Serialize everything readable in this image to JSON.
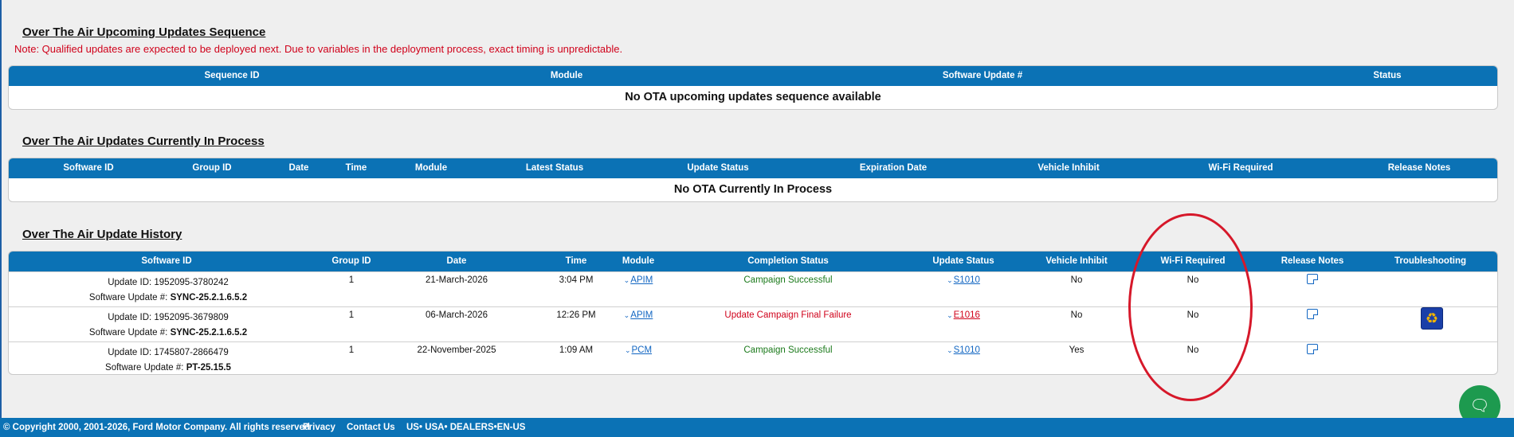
{
  "upcoming": {
    "title": "Over The Air Upcoming Updates Sequence",
    "note": "Note: Qualified updates are expected to be deployed next. Due to variables in the deployment process, exact timing is unpredictable.",
    "headers": [
      "Sequence ID",
      "Module",
      "Software Update #",
      "Status"
    ],
    "empty_message": "No OTA upcoming updates sequence available"
  },
  "in_process": {
    "title": "Over The Air Updates Currently In Process",
    "headers": [
      "Software ID",
      "Group ID",
      "Date",
      "Time",
      "Module",
      "Latest Status",
      "Update Status",
      "Expiration Date",
      "Vehicle Inhibit",
      "Wi-Fi Required",
      "Release Notes"
    ],
    "empty_message": "No OTA Currently In Process"
  },
  "history": {
    "title": "Over The Air Update History",
    "headers": [
      "Software ID",
      "Group ID",
      "Date",
      "Time",
      "Module",
      "Completion Status",
      "Update Status",
      "Vehicle Inhibit",
      "Wi-Fi Required",
      "Release Notes",
      "Troubleshooting"
    ],
    "software_update_label": "Software Update #:",
    "rows": [
      {
        "update_id": "Update ID: 1952095-3780242",
        "software_update": "SYNC-25.2.1.6.5.2",
        "group_id": "1",
        "date": "21-March-2026",
        "time": "3:04 PM",
        "module": "APIM",
        "completion_status": "Campaign Successful",
        "update_status": "S1010",
        "vehicle_inhibit": "No",
        "wifi_required": "No"
      },
      {
        "update_id": "Update ID: 1952095-3679809",
        "software_update": "SYNC-25.2.1.6.5.2",
        "group_id": "1",
        "date": "06-March-2026",
        "time": "12:26 PM",
        "module": "APIM",
        "completion_status": "Update Campaign Final Failure",
        "update_status": "E1016",
        "vehicle_inhibit": "No",
        "wifi_required": "No"
      },
      {
        "update_id": "Update ID: 1745807-2866479",
        "software_update": "PT-25.15.5",
        "group_id": "1",
        "date": "22-November-2025",
        "time": "1:09 AM",
        "module": "PCM",
        "completion_status": "Campaign Successful",
        "update_status": "S1010",
        "vehicle_inhibit": "Yes",
        "wifi_required": "No"
      }
    ]
  },
  "footer": {
    "copyright": "© Copyright 2000, 2001-2026, Ford Motor Company. All rights reserved",
    "privacy": "Privacy",
    "contact": "Contact Us",
    "locale": "US• USA• DEALERS•EN-US"
  },
  "colors": {
    "header_blue": "#0b72b5",
    "success_green": "#1b7a1b",
    "failure_red": "#d0021b",
    "annotation_red": "#d6182a",
    "chat_green": "#1d9a4f"
  },
  "icons": {
    "release_notes": "note-icon",
    "troubleshooting": "recycle-icon",
    "chat": "chat-bubble-icon",
    "dropdown": "chevron-down-icon"
  }
}
